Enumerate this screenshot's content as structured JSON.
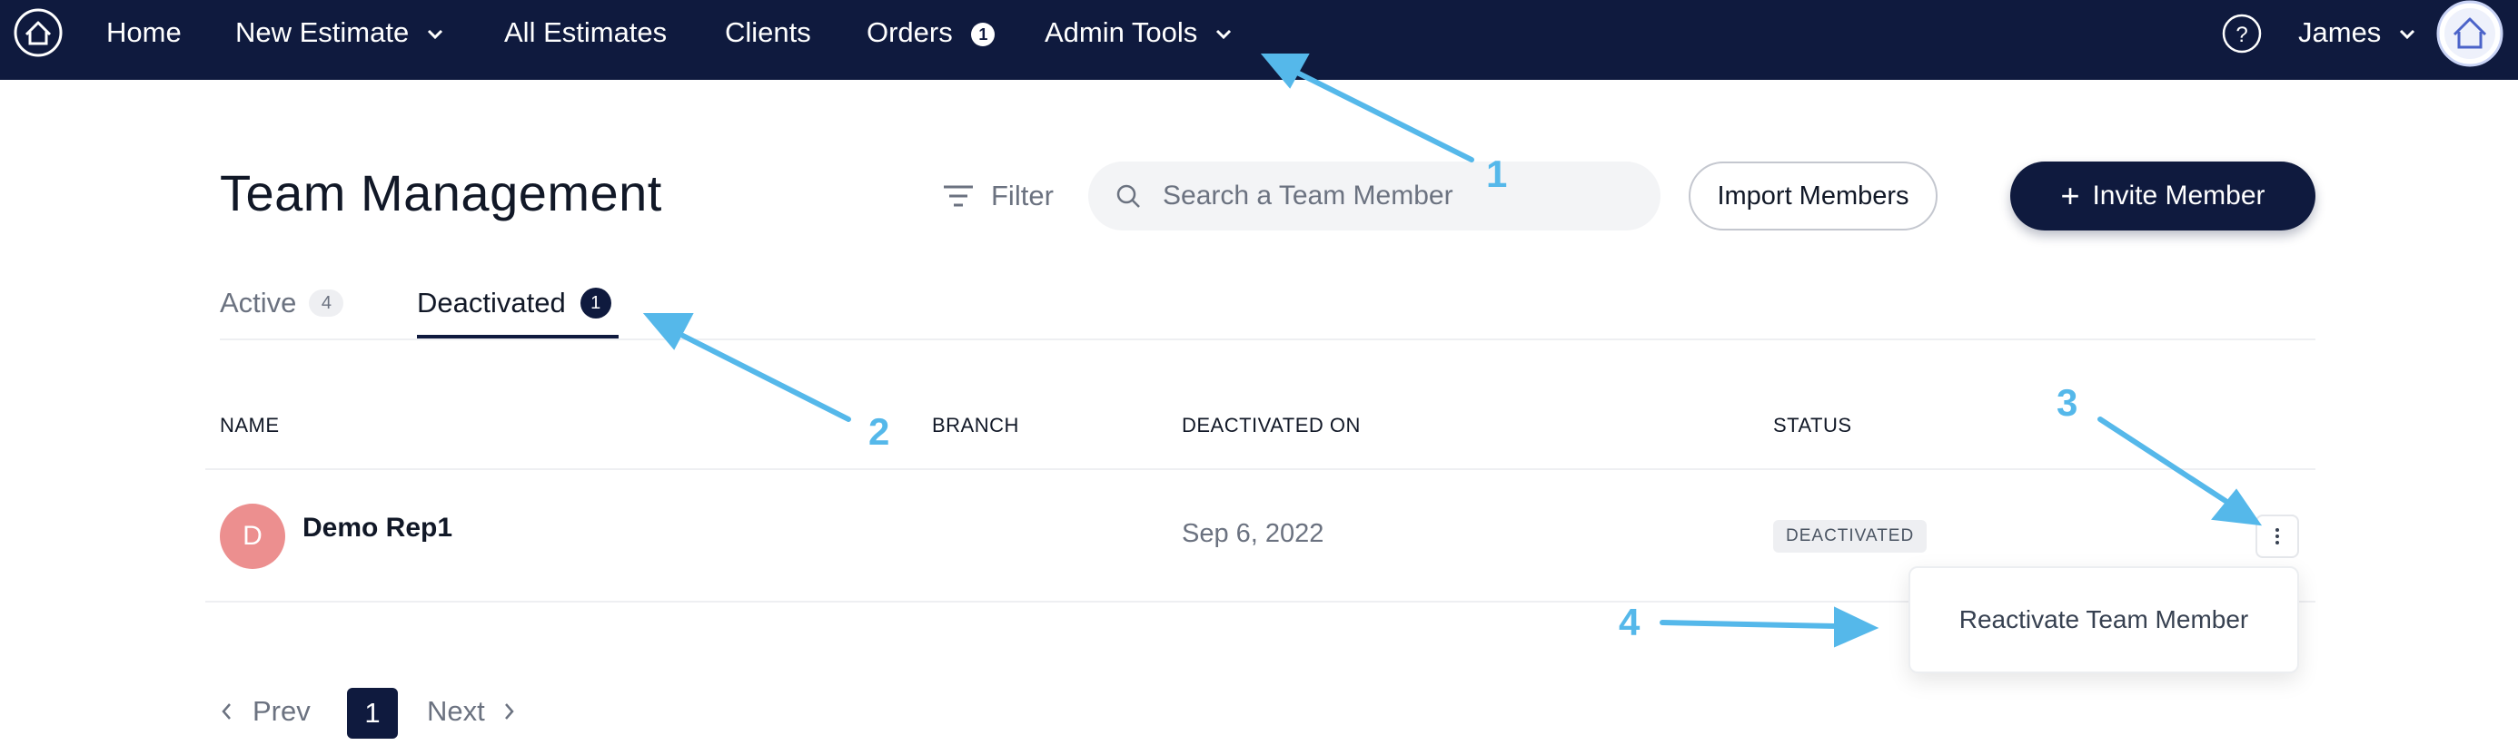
{
  "nav": {
    "items": [
      {
        "label": "Home"
      },
      {
        "label": "New Estimate"
      },
      {
        "label": "All Estimates"
      },
      {
        "label": "Clients"
      },
      {
        "label": "Orders",
        "badge": "1"
      },
      {
        "label": "Admin Tools"
      }
    ],
    "help_icon": "question-circle-icon",
    "user_name": "James",
    "bg_color": "#0f1a3e"
  },
  "page": {
    "title": "Team Management",
    "filter_label": "Filter",
    "search_placeholder": "Search a Team Member",
    "import_label": "Import Members",
    "invite_label": "Invite Member",
    "invite_icon": "+"
  },
  "tabs": [
    {
      "label": "Active",
      "count": "4",
      "active": false
    },
    {
      "label": "Deactivated",
      "count": "1",
      "active": true
    }
  ],
  "table": {
    "columns": [
      "NAME",
      "BRANCH",
      "DEACTIVATED ON",
      "STATUS"
    ],
    "rows": [
      {
        "initial": "D",
        "name": "Demo Rep1",
        "branch": "",
        "deactivated_on": "Sep 6, 2022",
        "status": "DEACTIVATED"
      }
    ]
  },
  "row_menu": {
    "items": [
      "Reactivate Team Member"
    ]
  },
  "pagination": {
    "prev": "Prev",
    "current": "1",
    "next": "Next"
  },
  "annotations": [
    "1",
    "2",
    "3",
    "4"
  ],
  "colors": {
    "accent": "#0f1a3e",
    "avatar": "#ec8f8f",
    "annotation": "#55b8ea"
  }
}
